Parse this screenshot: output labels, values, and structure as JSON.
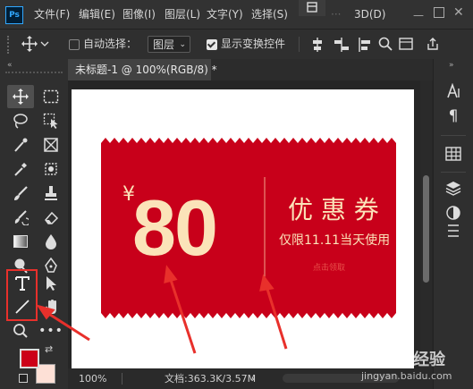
{
  "menubar": {
    "logo": "Ps",
    "items": [
      "文件(F)",
      "编辑(E)",
      "图像(I)",
      "图层(L)",
      "文字(Y)",
      "选择(S)",
      "3D(D)"
    ]
  },
  "options": {
    "auto_select_label": "自动选择：",
    "layer_select_value": "图层",
    "show_transform_label": "显示变换控件",
    "show_transform_checked": true,
    "auto_select_checked": false
  },
  "document": {
    "tab_title": "未标题-1 @ 100%(RGB/8) *",
    "zoom": "100%",
    "doc_info": "文档:363.3K/3.57M"
  },
  "coupon": {
    "currency": "¥",
    "amount": "80",
    "title": "优 惠 券",
    "subtitle": "仅限11.11当天使用",
    "link_text": "点击领取"
  },
  "watermark": {
    "brand": "Bai",
    "text": "经验",
    "url": "jingyan.baidu.com"
  },
  "colors": {
    "accent": "#e8302b",
    "coupon_red": "#c8001a",
    "coupon_text": "#fbe3b9",
    "foreground": "#cc0018",
    "background": "#fde0d6"
  }
}
